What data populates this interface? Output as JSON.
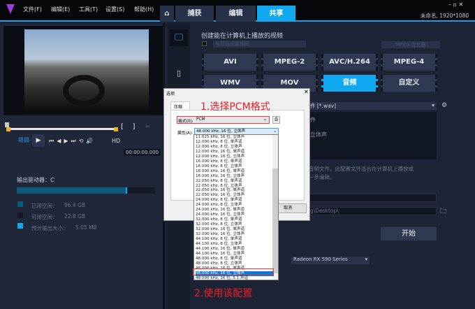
{
  "menu": [
    "文件(F)",
    "编辑(E)",
    "工具(T)",
    "设置(S)",
    "帮助(H)"
  ],
  "tabs": {
    "capture": "捕获",
    "edit": "编辑",
    "share": "共享"
  },
  "project_info": "未命名, 1920*1080",
  "player": {
    "project_label": "项目-",
    "hd": "HD",
    "timecode": "00:00:00.000"
  },
  "drive": {
    "label": "输出驱动器：C",
    "used_fraction": 0.8,
    "used_label": "已用空间：",
    "used_value": "96.4 GB",
    "free_label": "可用空间：",
    "free_value": "22.8 GB",
    "est_label": "预计输出大小：",
    "est_value": "5.05 MB",
    "colors": {
      "used": "#0e5a78",
      "free": "#141a28",
      "est": "#10a8f0"
    }
  },
  "share": {
    "title": "创建能在计算机上播放的视频",
    "same_as_project": "与项目设置相同",
    "mpeg_optimizer": "MPEG 优化器",
    "formats": [
      "AVI",
      "MPEG-2",
      "AVC/H.264",
      "MPEG-4",
      "WMV",
      "MOV",
      "音频",
      "自定义"
    ],
    "selected_format": "音频",
    "profile": "件 [*.wav]",
    "profile_info1": "件",
    "profile_info2": "立体声",
    "description1": "音频文件。此配置文件适合在计算机上播放或",
    "description2": "一步编辑。",
    "path": "g\\Desktop\\",
    "start": "开始",
    "gpu": "Radeon RX 590 Series"
  },
  "dialog": {
    "title": "选项",
    "tab": "压缩",
    "format_label": "格式(0):",
    "format_value": "PCM",
    "attr_label": "属性(A):",
    "attr_value": "48.000 kHz, 16 位, 立体声",
    "cancel": "取消",
    "options": [
      "11.025 kHz, 16 位, 立体声",
      "12.000 kHz, 8 位, 单声道",
      "12.000 kHz, 8 位, 立体声",
      "12.000 kHz, 16 位, 单声道",
      "12.000 kHz, 16 位, 立体声",
      "16.000 kHz, 8 位, 单声道",
      "16.000 kHz, 8 位, 立体声",
      "16.000 kHz, 16 位, 单声道",
      "16.000 kHz, 16 位, 立体声",
      "22.050 kHz, 8 位, 单声道",
      "22.050 kHz, 8 位, 立体声",
      "22.050 kHz, 16 位, 单声道",
      "22.050 kHz, 16 位, 立体声",
      "24.000 kHz, 8 位, 单声道",
      "24.000 kHz, 8 位, 立体声",
      "24.000 kHz, 16 位, 单声道",
      "24.000 kHz, 16 位, 立体声",
      "32.000 kHz, 8 位, 单声道",
      "32.000 kHz, 8 位, 立体声",
      "32.000 kHz, 16 位, 单声道",
      "32.000 kHz, 16 位, 立体声",
      "44.100 kHz, 8 位, 单声道",
      "44.100 kHz, 8 位, 立体声",
      "44.100 kHz, 16 位, 单声道",
      "44.100 kHz, 16 位, 立体声",
      "48.000 kHz, 8 位, 单声道",
      "48.000 kHz, 8 位, 立体声",
      "48.000 kHz, 16 位, 单声道",
      "48.000 kHz, 16 位, 立体声",
      "48.000 kHz, 16 位, 5.1 声道"
    ],
    "selected_index": 28
  },
  "annotations": {
    "step1": "1.选择PCM格式",
    "step2": "2.使用该配置"
  }
}
